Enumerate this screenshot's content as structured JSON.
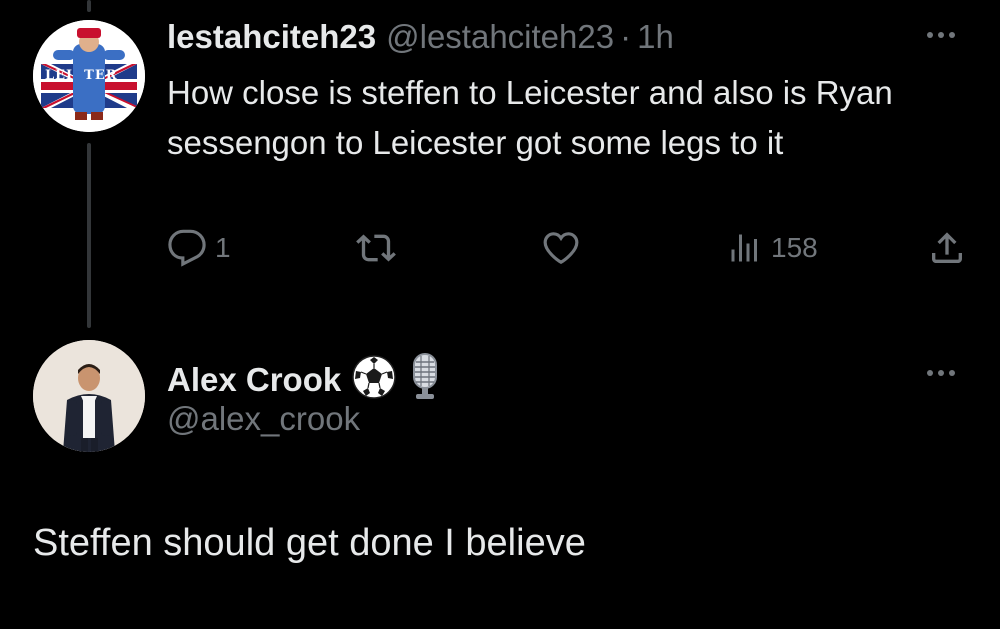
{
  "parent_tweet": {
    "display_name": "lestahciteh23",
    "handle": "@lestahciteh23",
    "separator": "·",
    "time": "1h",
    "avatar_text": "LEI  TER",
    "text": "How close is steffen to Leicester and also is Ryan sessengon to Leicester got some legs to it",
    "actions": {
      "reply_count": "1",
      "retweet_count": "",
      "like_count": "",
      "views_count": "158"
    }
  },
  "reply_tweet": {
    "display_name": "Alex Crook",
    "handle": "@alex_crook",
    "badges": [
      "soccer-ball-icon",
      "microphone-icon"
    ],
    "text": "Steffen should get done I believe"
  },
  "colors": {
    "background": "#000000",
    "primary_text": "#e7e9ea",
    "secondary_text": "#71767b",
    "thread_line": "#333639"
  }
}
